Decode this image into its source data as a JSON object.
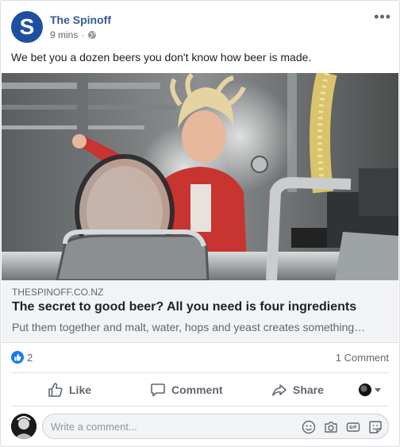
{
  "post": {
    "page_name": "The Spinoff",
    "avatar_letter": "S",
    "time": "9 mins",
    "privacy_icon": "globe-icon",
    "text": "We bet you a dozen beers you don't know how beer is made."
  },
  "link": {
    "domain": "THESPINOFF.CO.NZ",
    "title": "The secret to good beer? All you need is four ingredients",
    "description": "Put them together and malt, water, hops and yeast creates something…"
  },
  "stats": {
    "reaction_count": "2",
    "comment_count": "1 Comment"
  },
  "actions": {
    "like": "Like",
    "comment": "Comment",
    "share": "Share"
  },
  "composer": {
    "placeholder": "Write a comment..."
  },
  "colors": {
    "brand_blue": "#1f4fa0",
    "link_blue": "#385898",
    "like_blue": "#1877f2"
  }
}
